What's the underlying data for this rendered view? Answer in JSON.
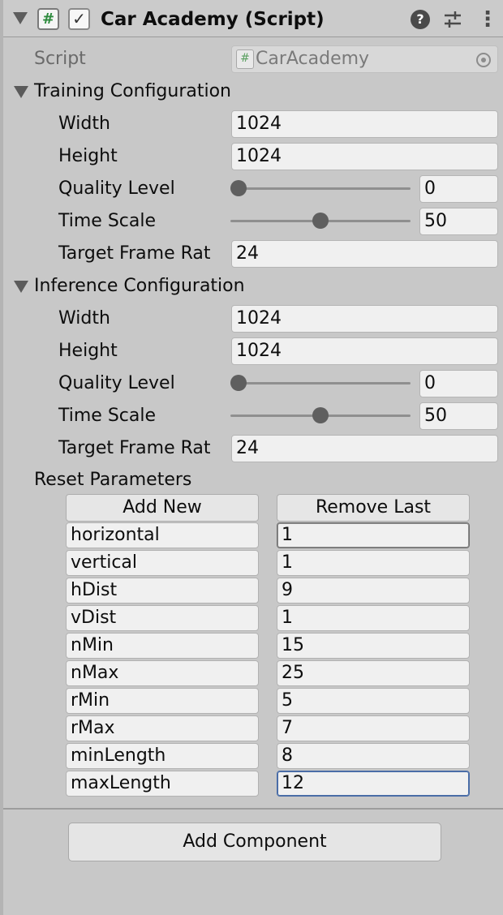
{
  "component": {
    "title": "Car Academy (Script)",
    "hash_icon": "#",
    "check_icon": "✓",
    "help_icon": "?",
    "menu_icon": "⋮"
  },
  "script": {
    "label": "Script",
    "value": "CarAcademy",
    "icon": "#"
  },
  "training": {
    "header": "Training Configuration",
    "width_label": "Width",
    "width": "1024",
    "height_label": "Height",
    "height": "1024",
    "quality_label": "Quality Level",
    "quality": "0",
    "quality_fraction": 0,
    "timescale_label": "Time Scale",
    "timescale": "50",
    "timescale_fraction": 0.5,
    "fps_label": "Target Frame Rat",
    "fps": "24"
  },
  "inference": {
    "header": "Inference Configuration",
    "width_label": "Width",
    "width": "1024",
    "height_label": "Height",
    "height": "1024",
    "quality_label": "Quality Level",
    "quality": "0",
    "quality_fraction": 0,
    "timescale_label": "Time Scale",
    "timescale": "50",
    "timescale_fraction": 0.5,
    "fps_label": "Target Frame Rat",
    "fps": "24"
  },
  "reset": {
    "header": "Reset Parameters",
    "add_label": "Add New",
    "remove_label": "Remove Last",
    "params": [
      {
        "key": "horizontal",
        "value": "1"
      },
      {
        "key": "vertical",
        "value": "1"
      },
      {
        "key": "hDist",
        "value": "9"
      },
      {
        "key": "vDist",
        "value": "1"
      },
      {
        "key": "nMin",
        "value": "15"
      },
      {
        "key": "nMax",
        "value": "25"
      },
      {
        "key": "rMin",
        "value": "5"
      },
      {
        "key": "rMax",
        "value": "7"
      },
      {
        "key": "minLength",
        "value": "8"
      },
      {
        "key": "maxLength",
        "value": "12"
      }
    ]
  },
  "add_component_label": "Add Component",
  "colors": {
    "focus_outline": "#4a6da7",
    "header_bg": "#cbcbcb",
    "panel_bg": "#c8c8c8"
  }
}
